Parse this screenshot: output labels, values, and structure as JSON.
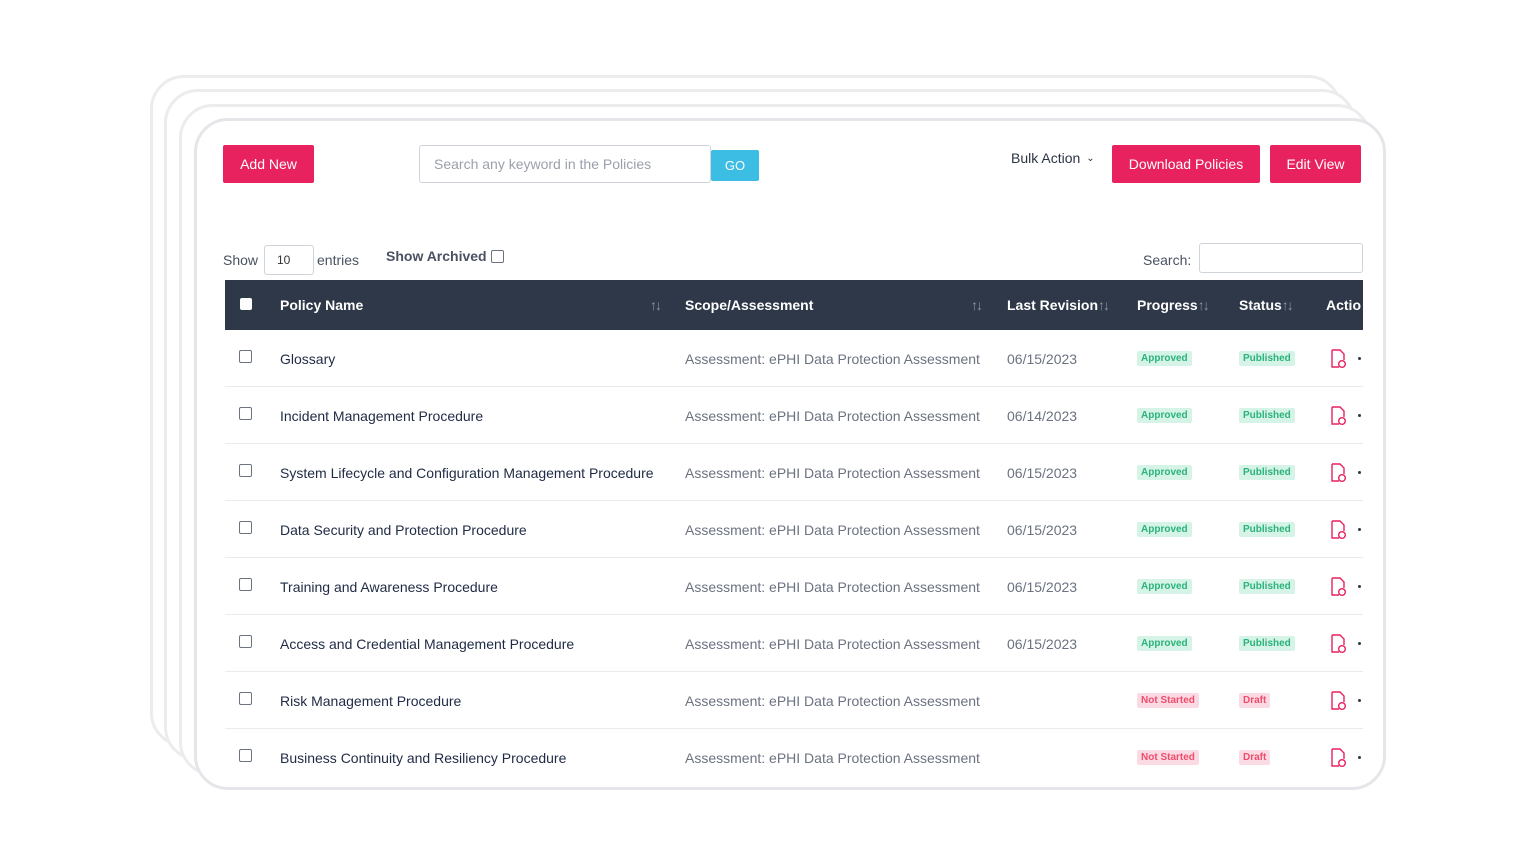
{
  "toolbar": {
    "add_new": "Add New",
    "search_placeholder": "Search any keyword in the Policies",
    "go": "GO",
    "bulk_action": "Bulk Action",
    "download_policies": "Download Policies",
    "edit_view": "Edit View"
  },
  "controls": {
    "show_label": "Show",
    "entries_value": "10",
    "entries_label": "entries",
    "show_archived": "Show Archived",
    "search_label": "Search:"
  },
  "table": {
    "columns": {
      "policy_name": "Policy Name",
      "scope": "Scope/Assessment",
      "last_revision": "Last Revision",
      "progress": "Progress",
      "status": "Status",
      "action": "Actio"
    },
    "rows": [
      {
        "name": "Glossary",
        "scope": "Assessment: ePHI Data Protection Assessment",
        "date": "06/15/2023",
        "progress": "Approved",
        "status": "Published"
      },
      {
        "name": "Incident Management Procedure",
        "scope": "Assessment: ePHI Data Protection Assessment",
        "date": "06/14/2023",
        "progress": "Approved",
        "status": "Published"
      },
      {
        "name": "System Lifecycle and Configuration Management Procedure",
        "scope": "Assessment: ePHI Data Protection Assessment",
        "date": "06/15/2023",
        "progress": "Approved",
        "status": "Published"
      },
      {
        "name": "Data Security and Protection Procedure",
        "scope": "Assessment: ePHI Data Protection Assessment",
        "date": "06/15/2023",
        "progress": "Approved",
        "status": "Published"
      },
      {
        "name": "Training and Awareness Procedure",
        "scope": "Assessment: ePHI Data Protection Assessment",
        "date": "06/15/2023",
        "progress": "Approved",
        "status": "Published"
      },
      {
        "name": "Access and Credential Management Procedure",
        "scope": "Assessment: ePHI Data Protection Assessment",
        "date": "06/15/2023",
        "progress": "Approved",
        "status": "Published"
      },
      {
        "name": "Risk Management Procedure",
        "scope": "Assessment: ePHI Data Protection Assessment",
        "date": "",
        "progress": "Not Started",
        "status": "Draft"
      },
      {
        "name": "Business Continuity and Resiliency Procedure",
        "scope": "Assessment: ePHI Data Protection Assessment",
        "date": "",
        "progress": "Not Started",
        "status": "Draft"
      }
    ]
  },
  "icons": {
    "action": "pdf-document-icon",
    "sort": "sort-arrows-icon",
    "bulk_chevron": "chevron-down-icon"
  },
  "colors": {
    "primary": "#e8215f",
    "go_button": "#3cbde3",
    "table_header": "#2e3848",
    "badge_green_bg": "#d6f3e7",
    "badge_green_text": "#2ab37a",
    "badge_red_bg": "#fbdbe3",
    "badge_red_text": "#ef4c6d"
  }
}
